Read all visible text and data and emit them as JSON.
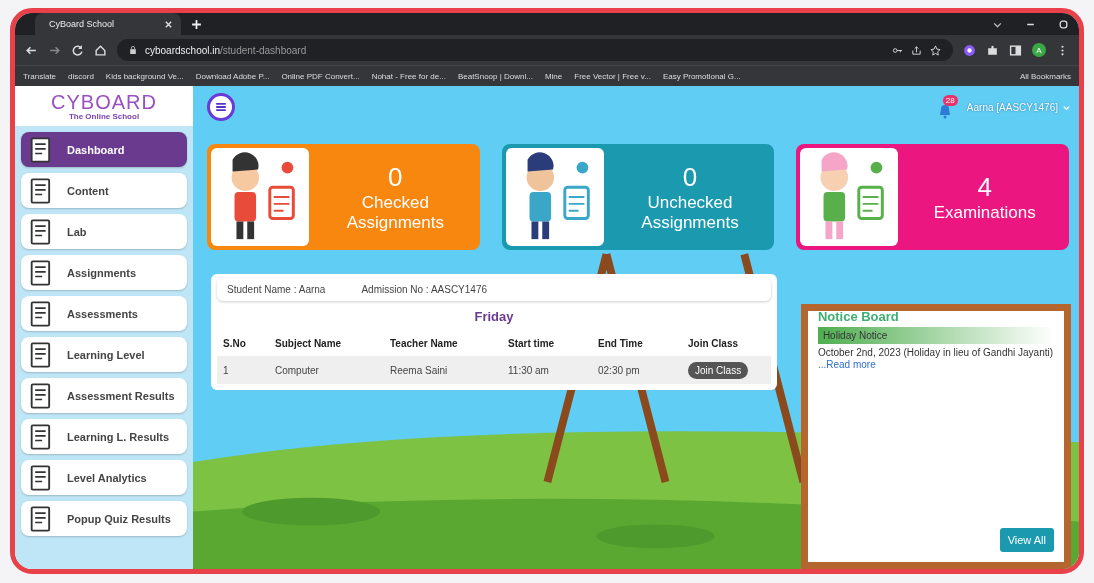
{
  "browser": {
    "tab_title": "CyBoard School",
    "url_host": "cyboardschool.in",
    "url_path": "/student-dashboard",
    "profile_initial": "A",
    "all_bookmarks": "All Bookmarks",
    "bookmarks": [
      "Translate",
      "discord",
      "Kids background Ve...",
      "Download Adobe P...",
      "Online PDF Convert...",
      "Nohat - Free for de...",
      "BeatSnoop | Downl...",
      "Mine",
      "Free Vector | Free v...",
      "Easy Promotional G..."
    ]
  },
  "app": {
    "logo": "CYBOARD",
    "logo_tagline": "The Online School",
    "notification_count": "28",
    "user": "Aarna [AASCY1476]"
  },
  "sidebar": {
    "items": [
      {
        "label": "Dashboard",
        "selected": true
      },
      {
        "label": "Content",
        "selected": false
      },
      {
        "label": "Lab",
        "selected": false
      },
      {
        "label": "Assignments",
        "selected": false
      },
      {
        "label": "Assessments",
        "selected": false
      },
      {
        "label": "Learning Level",
        "selected": false
      },
      {
        "label": "Assessment Results",
        "selected": false
      },
      {
        "label": "Learning L. Results",
        "selected": false
      },
      {
        "label": "Level Analytics",
        "selected": false
      },
      {
        "label": "Popup Quiz Results",
        "selected": false
      }
    ]
  },
  "stats": [
    {
      "count": "0",
      "label": "Checked Assignments",
      "color": "#f7870f"
    },
    {
      "count": "0",
      "label": "Unchecked Assignments",
      "color": "#1b9aaf"
    },
    {
      "count": "4",
      "label": "Examinations",
      "color": "#ec1680"
    }
  ],
  "schedule": {
    "student_name": "Student Name : Aarna",
    "admission_no": "Admission No : AASCY1476",
    "day": "Friday",
    "columns": [
      "S.No",
      "Subject Name",
      "Teacher Name",
      "Start time",
      "End Time",
      "Join Class"
    ],
    "rows": [
      {
        "cells": [
          "1",
          "Computer",
          "Reema Saini",
          "11:30 am",
          "02:30 pm"
        ],
        "action": "Join Class"
      }
    ]
  },
  "notice_board": {
    "title": "Notice Board",
    "notices": [
      {
        "title": "Holiday Notice",
        "text": "October 2nd, 2023 (Holiday in lieu of Gandhi Jayanti)",
        "link": "...Read more"
      }
    ],
    "button": "View All"
  }
}
